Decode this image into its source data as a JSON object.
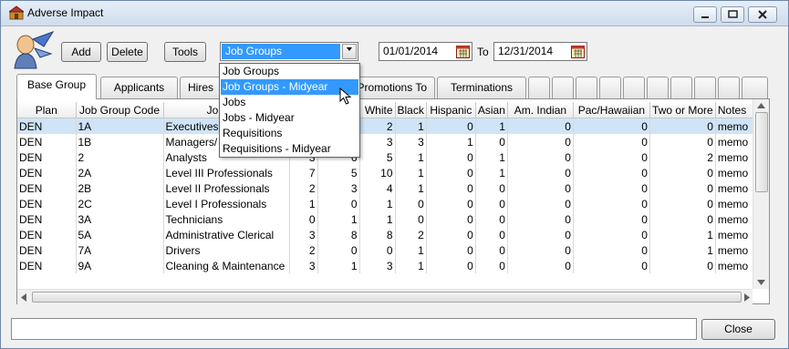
{
  "window": {
    "title": "Adverse Impact"
  },
  "toolbar": {
    "add_label": "Add",
    "delete_label": "Delete",
    "tools_label": "Tools",
    "group_select_value": "Job Groups",
    "date_from": "01/01/2014",
    "to_label": "To",
    "date_to": "12/31/2014"
  },
  "dropdown": {
    "options": [
      "Job Groups",
      "Job Groups - Midyear",
      "Jobs",
      "Jobs - Midyear",
      "Requisitions",
      "Requisitions - Midyear"
    ],
    "highlighted": "Job Groups - Midyear"
  },
  "tabs": [
    "Base Group",
    "Applicants",
    "Hires",
    "Promotions To",
    "Terminations"
  ],
  "active_tab": "Base Group",
  "grid": {
    "columns": [
      "Plan",
      "Job Group Code",
      "Job Gro",
      "",
      "",
      "White",
      "Black",
      "Hispanic",
      "Asian",
      "Am. Indian",
      "Pac/Hawaiian",
      "Two or More",
      "Notes"
    ],
    "rows": [
      [
        "DEN",
        "1A",
        "Executives",
        "",
        "",
        "2",
        "1",
        "0",
        "1",
        "0",
        "0",
        "0",
        "memo"
      ],
      [
        "DEN",
        "1B",
        "Managers/",
        "",
        "",
        "3",
        "3",
        "1",
        "0",
        "0",
        "0",
        "0",
        "memo"
      ],
      [
        "DEN",
        "2",
        "Analysts",
        "3",
        "6",
        "5",
        "1",
        "0",
        "1",
        "0",
        "0",
        "2",
        "memo"
      ],
      [
        "DEN",
        "2A",
        "Level III Professionals",
        "7",
        "5",
        "10",
        "1",
        "0",
        "1",
        "0",
        "0",
        "0",
        "memo"
      ],
      [
        "DEN",
        "2B",
        "Level II Professionals",
        "2",
        "3",
        "4",
        "1",
        "0",
        "0",
        "0",
        "0",
        "0",
        "memo"
      ],
      [
        "DEN",
        "2C",
        "Level I Professionals",
        "1",
        "0",
        "1",
        "0",
        "0",
        "0",
        "0",
        "0",
        "0",
        "memo"
      ],
      [
        "DEN",
        "3A",
        "Technicians",
        "0",
        "1",
        "1",
        "0",
        "0",
        "0",
        "0",
        "0",
        "0",
        "memo"
      ],
      [
        "DEN",
        "5A",
        "Administrative Clerical",
        "3",
        "8",
        "8",
        "2",
        "0",
        "0",
        "0",
        "0",
        "1",
        "memo"
      ],
      [
        "DEN",
        "7A",
        "Drivers",
        "2",
        "0",
        "0",
        "1",
        "0",
        "0",
        "0",
        "0",
        "1",
        "memo"
      ],
      [
        "DEN",
        "9A",
        "Cleaning & Maintenance",
        "3",
        "1",
        "3",
        "1",
        "0",
        "0",
        "0",
        "0",
        "0",
        "memo"
      ]
    ]
  },
  "close_label": "Close"
}
